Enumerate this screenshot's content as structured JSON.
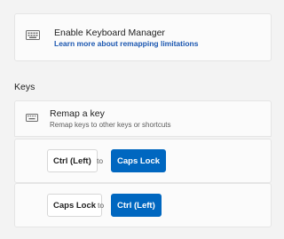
{
  "enable": {
    "title": "Enable Keyboard Manager",
    "link": "Learn more about remapping limitations",
    "icon": "keyboard-icon"
  },
  "keys_section": {
    "header": "Keys",
    "remap": {
      "title": "Remap a key",
      "subtitle": "Remap keys to other keys or shortcuts",
      "icon": "keyboard-small-icon"
    },
    "mappings": [
      {
        "from": "Ctrl (Left)",
        "to_label": "to",
        "to": "Caps Lock"
      },
      {
        "from": "Caps Lock",
        "to_label": "to",
        "to": "Ctrl (Left)"
      }
    ]
  },
  "colors": {
    "accent": "#0067c0",
    "link": "#1a56b0",
    "background": "#f3f3f3",
    "card": "#fbfbfb"
  }
}
